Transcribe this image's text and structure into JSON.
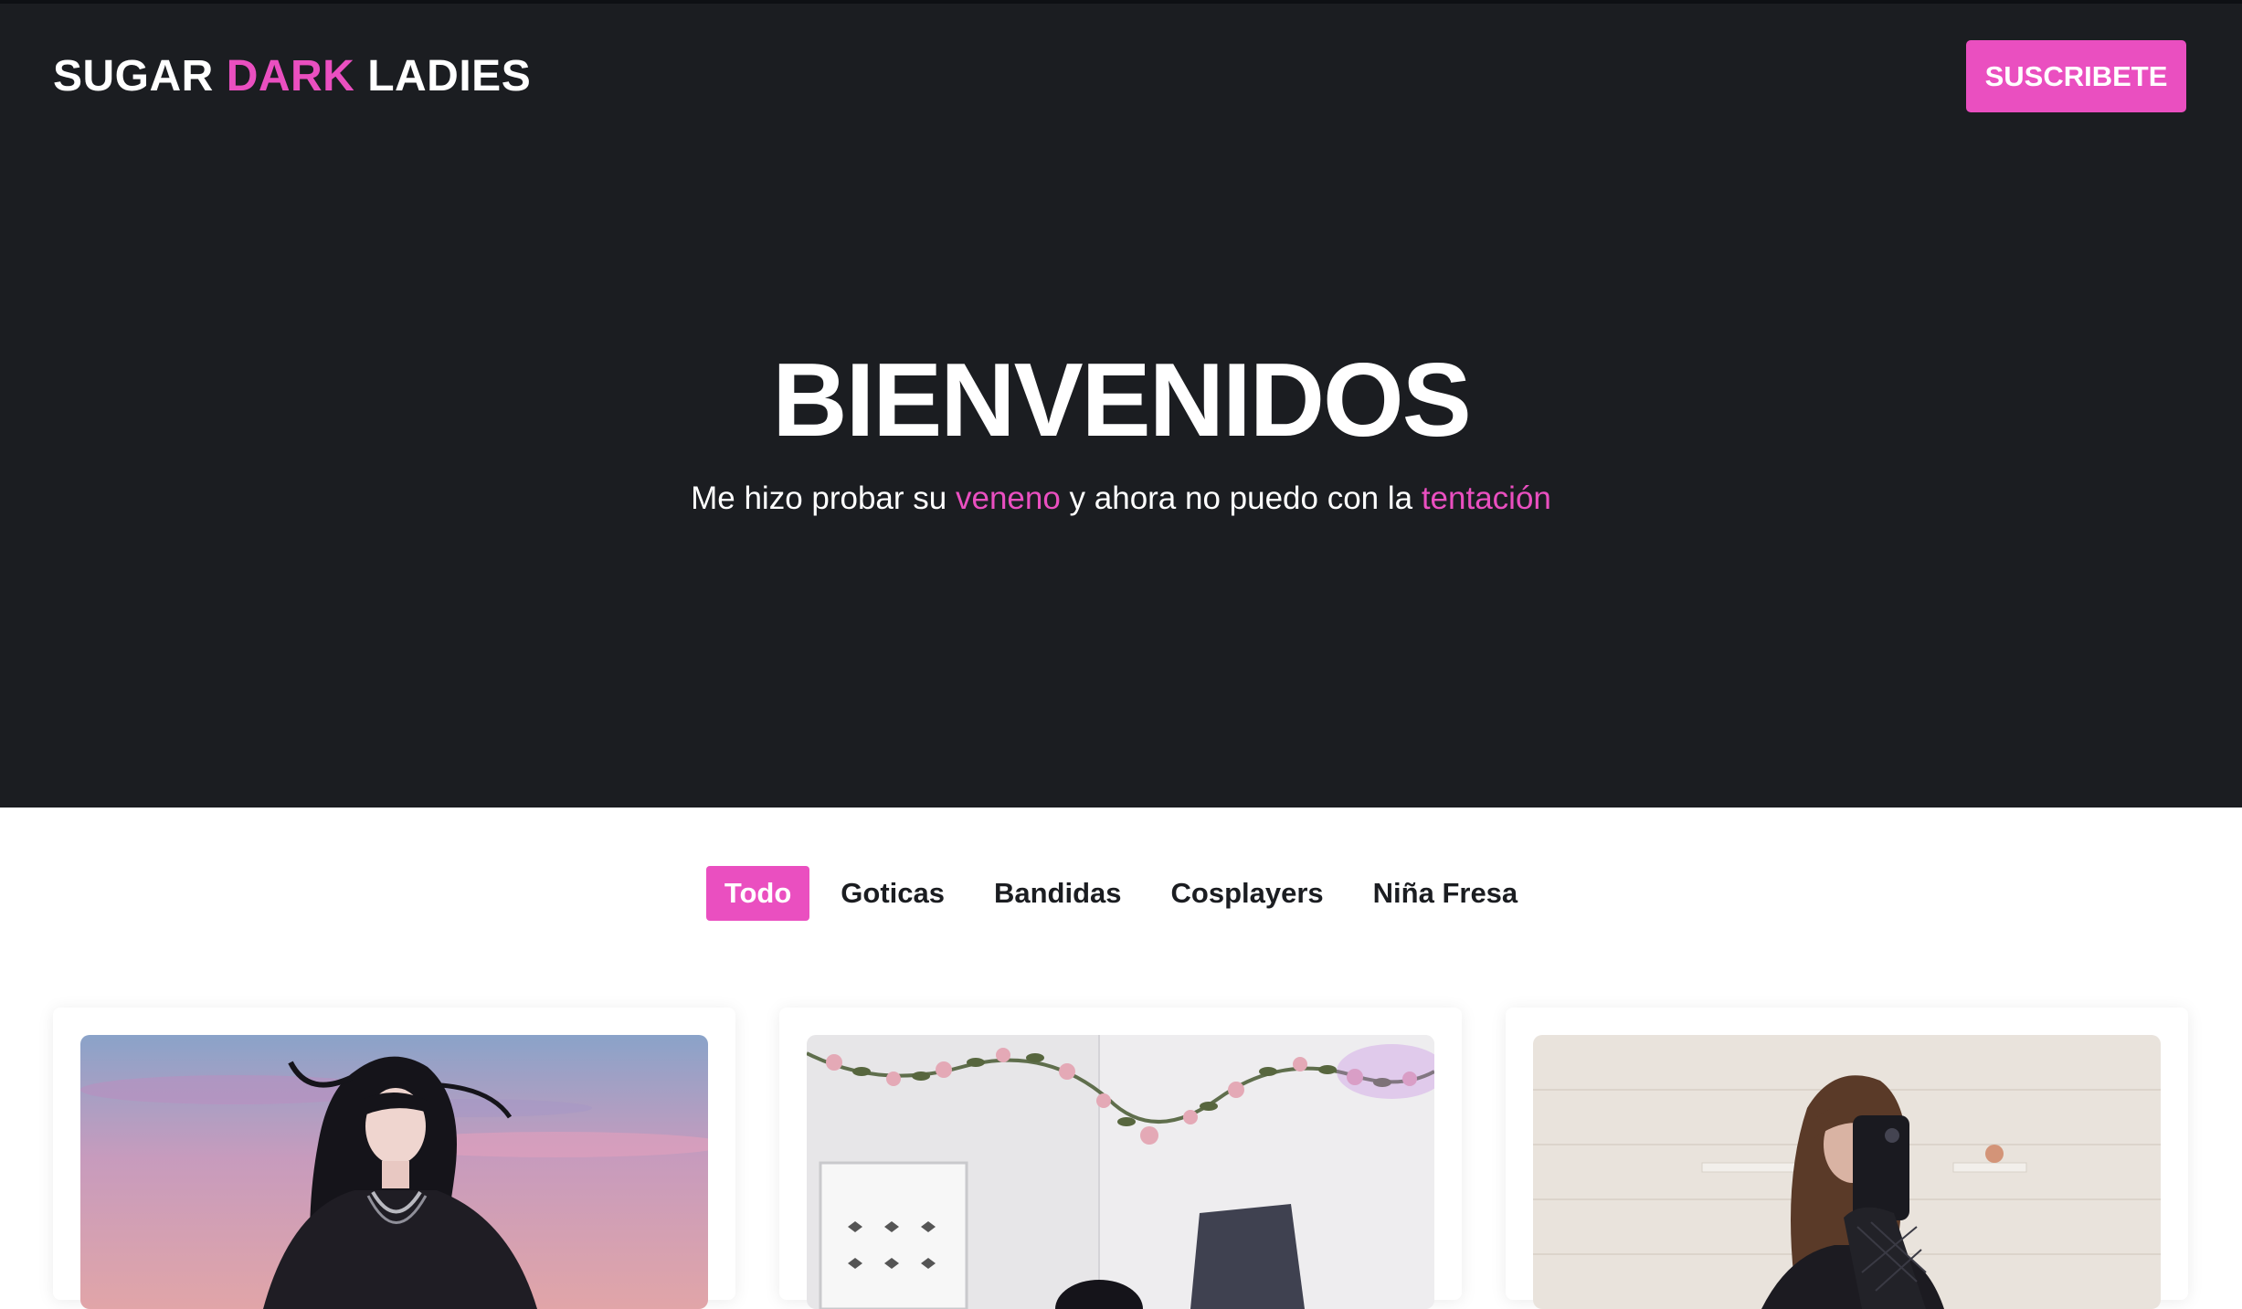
{
  "header": {
    "logo": {
      "part1": "SUGAR",
      "part2": "DARK",
      "part3": "LADIES"
    },
    "subscribe_label": "SUSCRIBETE"
  },
  "hero": {
    "title": "BIENVENIDOS",
    "subtitle": {
      "text1": "Me hizo probar su ",
      "highlight1": "veneno",
      "text2": " y ahora no puedo con la ",
      "highlight2": "tentación"
    }
  },
  "filters": [
    {
      "label": "Todo",
      "active": true
    },
    {
      "label": "Goticas",
      "active": false
    },
    {
      "label": "Bandidas",
      "active": false
    },
    {
      "label": "Cosplayers",
      "active": false
    },
    {
      "label": "Niña Fresa",
      "active": false
    }
  ],
  "colors": {
    "accent": "#ea4fc0",
    "hero_bg": "#1b1d21",
    "page_bg": "#ffffff"
  }
}
